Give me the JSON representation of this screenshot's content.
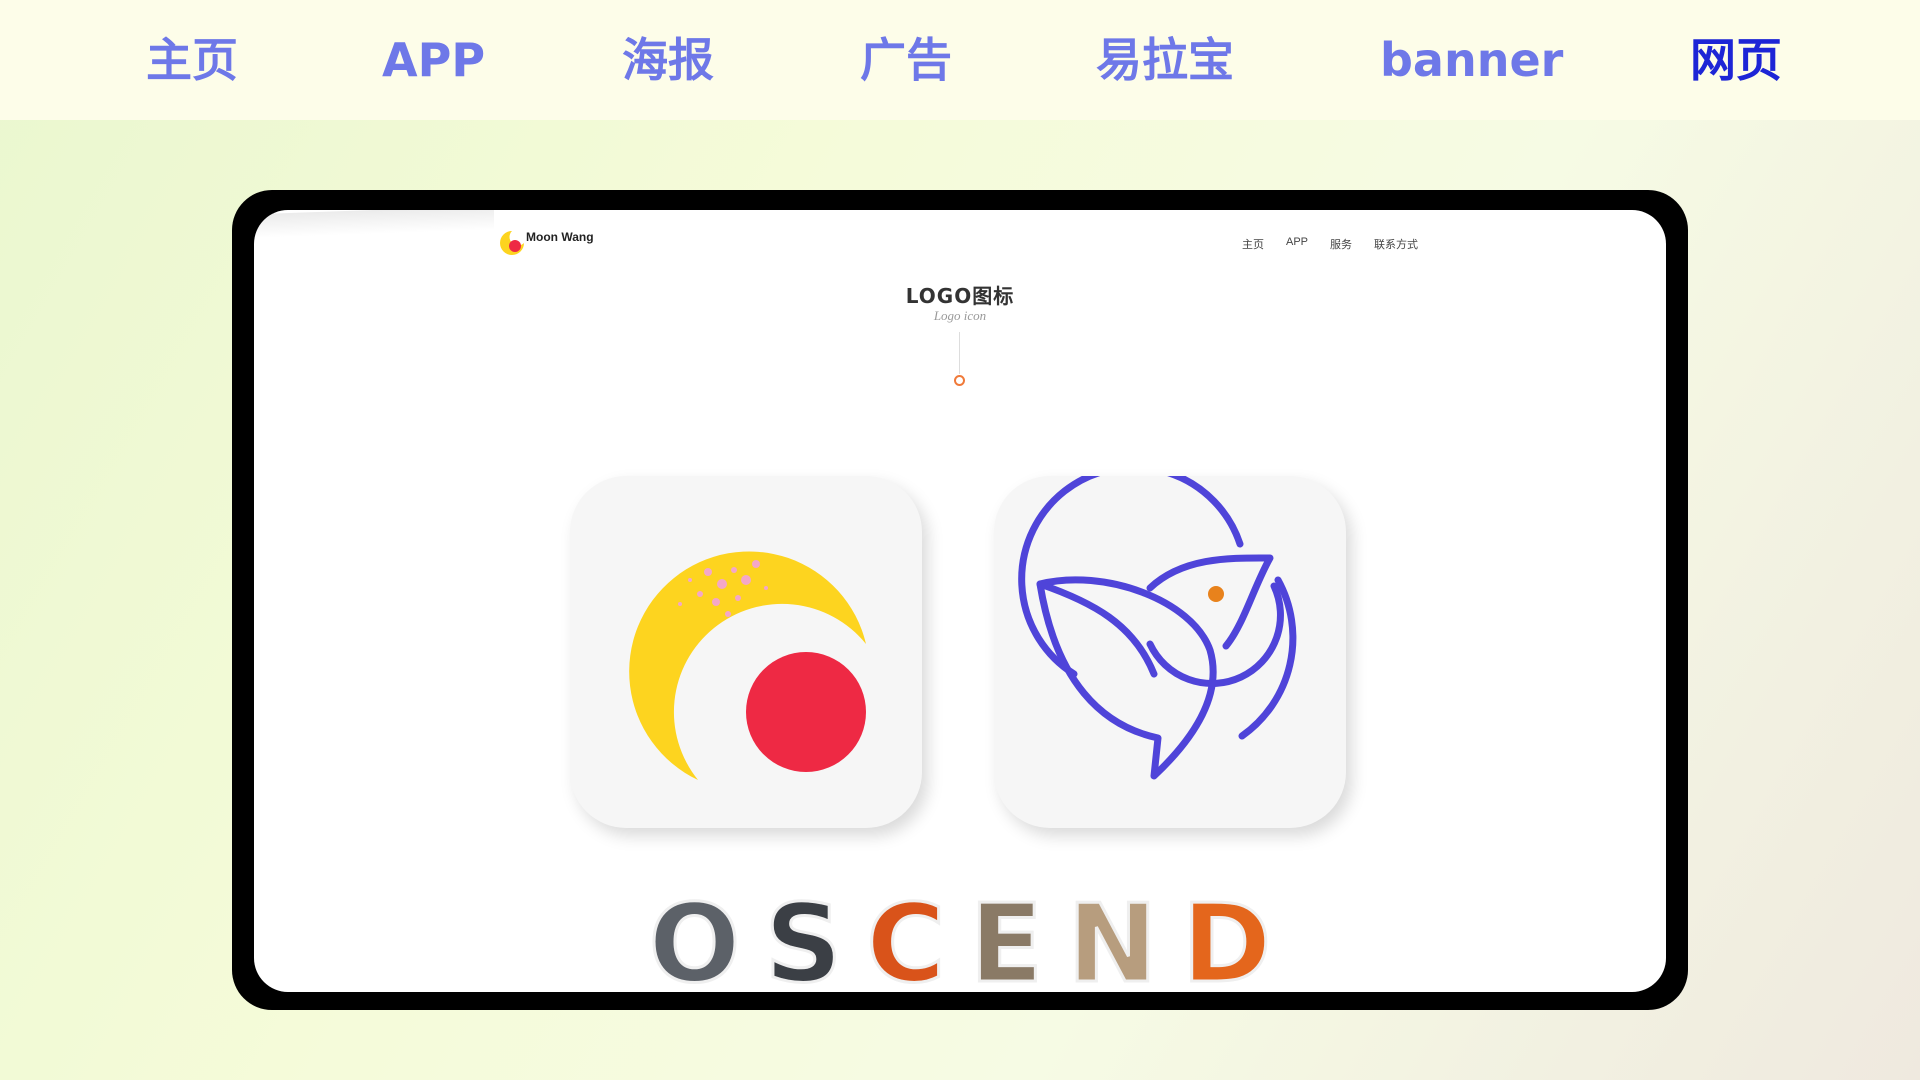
{
  "top_nav": {
    "items": [
      {
        "label": "主页"
      },
      {
        "label": "APP"
      },
      {
        "label": "海报"
      },
      {
        "label": "广告"
      },
      {
        "label": "易拉宝"
      },
      {
        "label": "banner"
      },
      {
        "label": "网页"
      }
    ],
    "active_label": "网页",
    "color": "#6e78e8",
    "active_color": "#1d25d6"
  },
  "site": {
    "brand_name": "Moon Wang",
    "nav": [
      "主页",
      "APP",
      "服务",
      "联系方式"
    ]
  },
  "section": {
    "title": "LOGO图标",
    "subtitle": "Logo icon"
  },
  "logos": [
    {
      "icon": "moon-logo-icon",
      "colors": [
        "#fdd41f",
        "#ee2944"
      ]
    },
    {
      "icon": "bird-logo-icon",
      "colors": [
        "#4f44d9",
        "#e8821c"
      ]
    }
  ],
  "wordmark": {
    "letters": [
      "O",
      "S",
      "C",
      "E",
      "N",
      "D"
    ],
    "colors": [
      "#5c6168",
      "#3b3f45",
      "#d9531a",
      "#8a7a66",
      "#b79d7e",
      "#e4661c"
    ]
  }
}
